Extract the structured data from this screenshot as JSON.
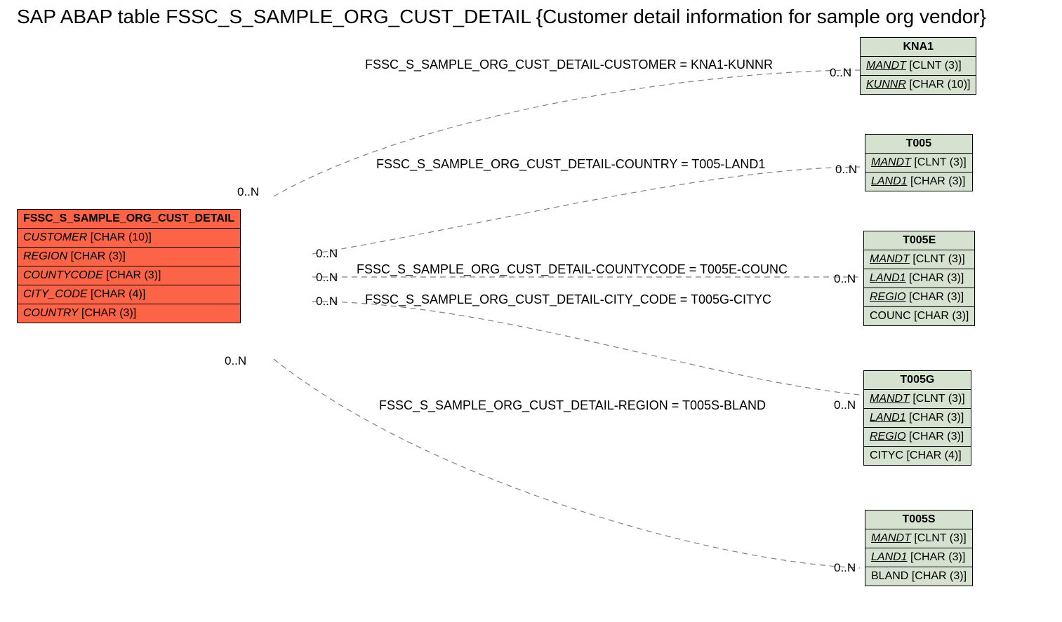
{
  "title": "SAP ABAP table FSSC_S_SAMPLE_ORG_CUST_DETAIL {Customer detail information for sample org vendor}",
  "main": {
    "name": "FSSC_S_SAMPLE_ORG_CUST_DETAIL",
    "fields": [
      {
        "name": "CUSTOMER",
        "type": "[CHAR (10)]"
      },
      {
        "name": "REGION",
        "type": "[CHAR (3)]"
      },
      {
        "name": "COUNTYCODE",
        "type": "[CHAR (3)]"
      },
      {
        "name": "CITY_CODE",
        "type": "[CHAR (4)]"
      },
      {
        "name": "COUNTRY",
        "type": "[CHAR (3)]"
      }
    ]
  },
  "refs": {
    "kna1": {
      "name": "KNA1",
      "fields": [
        {
          "name": "MANDT",
          "type": "[CLNT (3)]",
          "key": true
        },
        {
          "name": "KUNNR",
          "type": "[CHAR (10)]",
          "key": true
        }
      ]
    },
    "t005": {
      "name": "T005",
      "fields": [
        {
          "name": "MANDT",
          "type": "[CLNT (3)]",
          "key": true
        },
        {
          "name": "LAND1",
          "type": "[CHAR (3)]",
          "key": true
        }
      ]
    },
    "t005e": {
      "name": "T005E",
      "fields": [
        {
          "name": "MANDT",
          "type": "[CLNT (3)]",
          "key": true
        },
        {
          "name": "LAND1",
          "type": "[CHAR (3)]",
          "key": true
        },
        {
          "name": "REGIO",
          "type": "[CHAR (3)]",
          "key": true
        },
        {
          "name": "COUNC",
          "type": "[CHAR (3)]",
          "key": false
        }
      ]
    },
    "t005g": {
      "name": "T005G",
      "fields": [
        {
          "name": "MANDT",
          "type": "[CLNT (3)]",
          "key": true
        },
        {
          "name": "LAND1",
          "type": "[CHAR (3)]",
          "key": true
        },
        {
          "name": "REGIO",
          "type": "[CHAR (3)]",
          "key": true
        },
        {
          "name": "CITYC",
          "type": "[CHAR (4)]",
          "key": false
        }
      ]
    },
    "t005s": {
      "name": "T005S",
      "fields": [
        {
          "name": "MANDT",
          "type": "[CLNT (3)]",
          "key": true
        },
        {
          "name": "LAND1",
          "type": "[CHAR (3)]",
          "key": true
        },
        {
          "name": "BLAND",
          "type": "[CHAR (3)]",
          "key": false
        }
      ]
    }
  },
  "rels": {
    "r1": "FSSC_S_SAMPLE_ORG_CUST_DETAIL-CUSTOMER = KNA1-KUNNR",
    "r2": "FSSC_S_SAMPLE_ORG_CUST_DETAIL-COUNTRY = T005-LAND1",
    "r3": "FSSC_S_SAMPLE_ORG_CUST_DETAIL-COUNTYCODE = T005E-COUNC",
    "r4": "FSSC_S_SAMPLE_ORG_CUST_DETAIL-CITY_CODE = T005G-CITYC",
    "r5": "FSSC_S_SAMPLE_ORG_CUST_DETAIL-REGION = T005S-BLAND"
  },
  "card": "0..N"
}
